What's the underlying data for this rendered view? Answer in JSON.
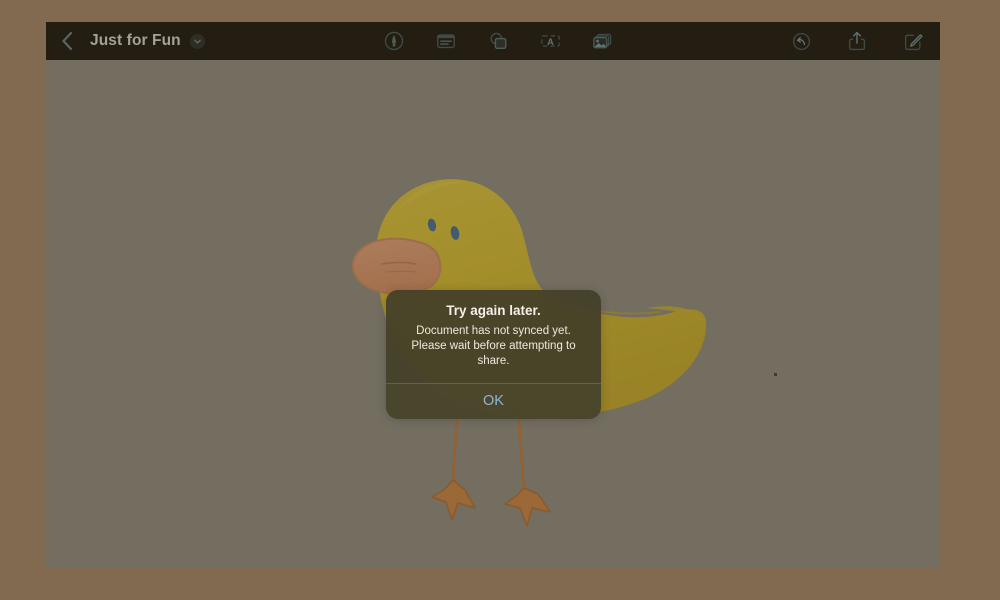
{
  "window": {
    "canvas_background": "#8a8a8a",
    "page_background": "#816a4f",
    "toolbar_background": "#0d0d0f"
  },
  "toolbar": {
    "back_label": "back-chevron",
    "document_title": "Just for Fun",
    "title_badge_icon": "chevron-down-icon",
    "center_tools": [
      {
        "name": "ink-tool-icon",
        "label": "Ink"
      },
      {
        "name": "text-note-icon",
        "label": "Note"
      },
      {
        "name": "shapes-icon",
        "label": "Shapes"
      },
      {
        "name": "text-box-icon",
        "label": "Text Box"
      },
      {
        "name": "media-icon",
        "label": "Media"
      }
    ],
    "right_tools": [
      {
        "name": "undo-icon",
        "label": "Undo"
      },
      {
        "name": "share-icon",
        "label": "Share"
      },
      {
        "name": "compose-icon",
        "label": "Compose"
      }
    ]
  },
  "artwork": {
    "name": "duck-drawing",
    "body_color": "#d8bf3c",
    "beak_color": "#dd9779",
    "eye_color": "#3f6e9e",
    "leg_color": "#c1743f"
  },
  "alert": {
    "title": "Try again later.",
    "message": "Document has not synced yet. Please wait before attempting to share.",
    "ok_label": "OK",
    "ok_color": "#8fb4d4"
  }
}
